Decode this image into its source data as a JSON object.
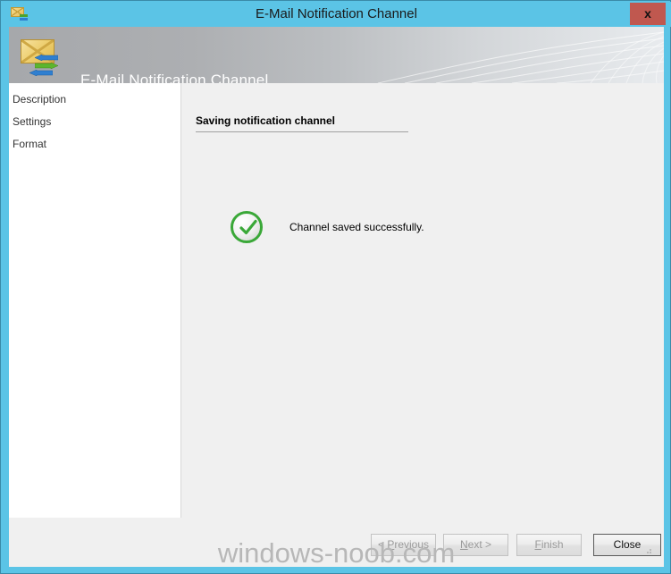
{
  "window": {
    "titlebar": {
      "title": "E-Mail Notification Channel",
      "icon": "email-notification-icon",
      "close_label": "x",
      "background_color": "#5bc4e6"
    },
    "banner": {
      "title": "E-Mail Notification Channel",
      "icon": "email-transfer-icon"
    }
  },
  "sidebar": {
    "items": [
      {
        "label": "Description"
      },
      {
        "label": "Settings"
      },
      {
        "label": "Format"
      }
    ]
  },
  "main": {
    "section_title": "Saving notification channel",
    "status": {
      "icon": "green-check-circle-icon",
      "message": "Channel saved successfully.",
      "color": "#3aa838"
    }
  },
  "footer": {
    "buttons": [
      {
        "label": "< Previous",
        "mnemonic": "P",
        "enabled": false
      },
      {
        "label": "Next >",
        "mnemonic": "N",
        "enabled": false
      },
      {
        "label": "Finish",
        "mnemonic": "F",
        "enabled": false
      },
      {
        "label": "Close",
        "mnemonic": "",
        "enabled": true
      }
    ]
  },
  "watermark": {
    "text": "windows-noob.com"
  }
}
